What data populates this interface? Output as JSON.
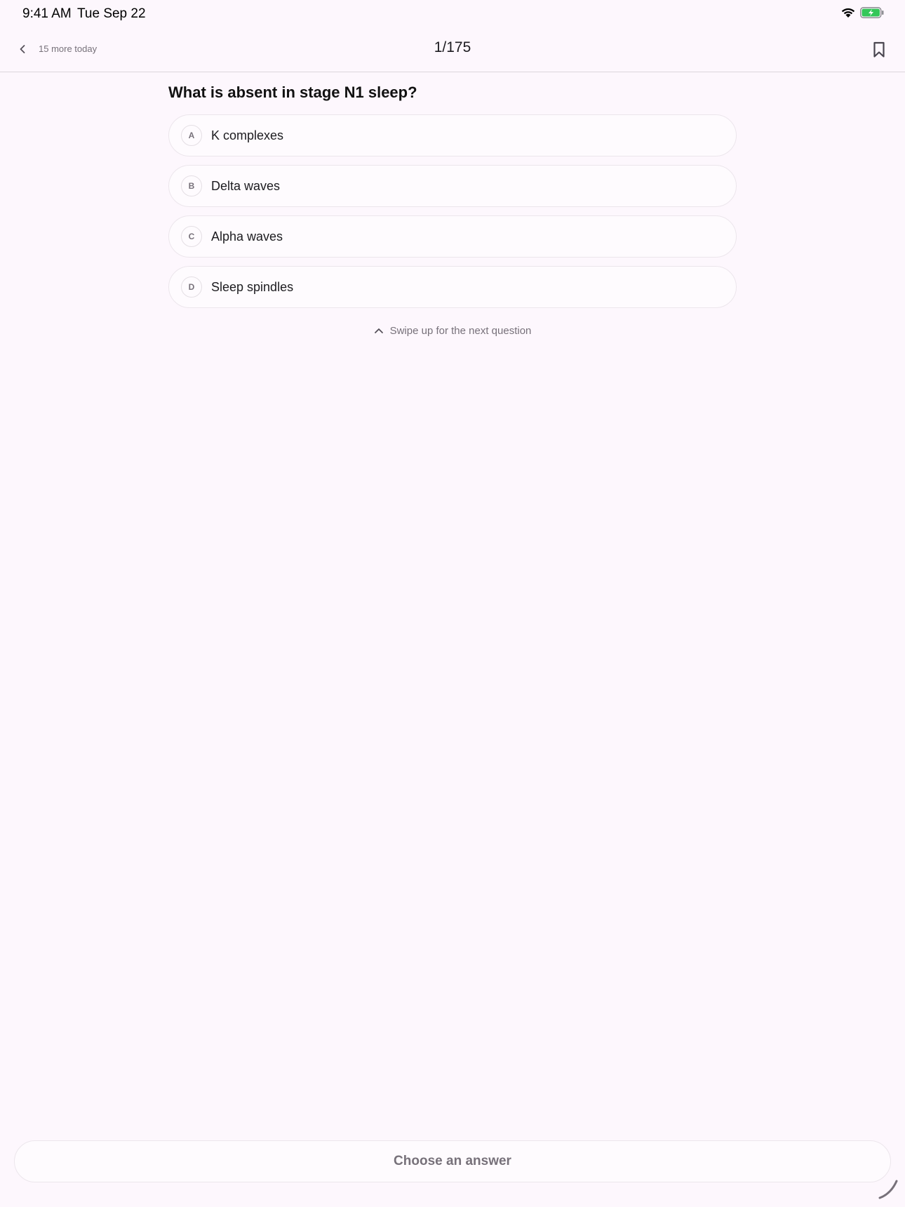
{
  "status_bar": {
    "time": "9:41 AM",
    "date": "Tue Sep 22"
  },
  "header": {
    "remaining_label": "15 more today",
    "progress": "1/175"
  },
  "question": {
    "text": "What is absent in stage N1 sleep?",
    "options": [
      {
        "letter": "A",
        "text": "K complexes"
      },
      {
        "letter": "B",
        "text": "Delta waves"
      },
      {
        "letter": "C",
        "text": "Alpha waves"
      },
      {
        "letter": "D",
        "text": "Sleep spindles"
      }
    ]
  },
  "swipe_hint": "Swipe up for the next question",
  "footer": {
    "choose_label": "Choose an answer"
  },
  "colors": {
    "background": "#fdf7fd",
    "secondary_text": "#77717a",
    "battery_green": "#34c759"
  }
}
